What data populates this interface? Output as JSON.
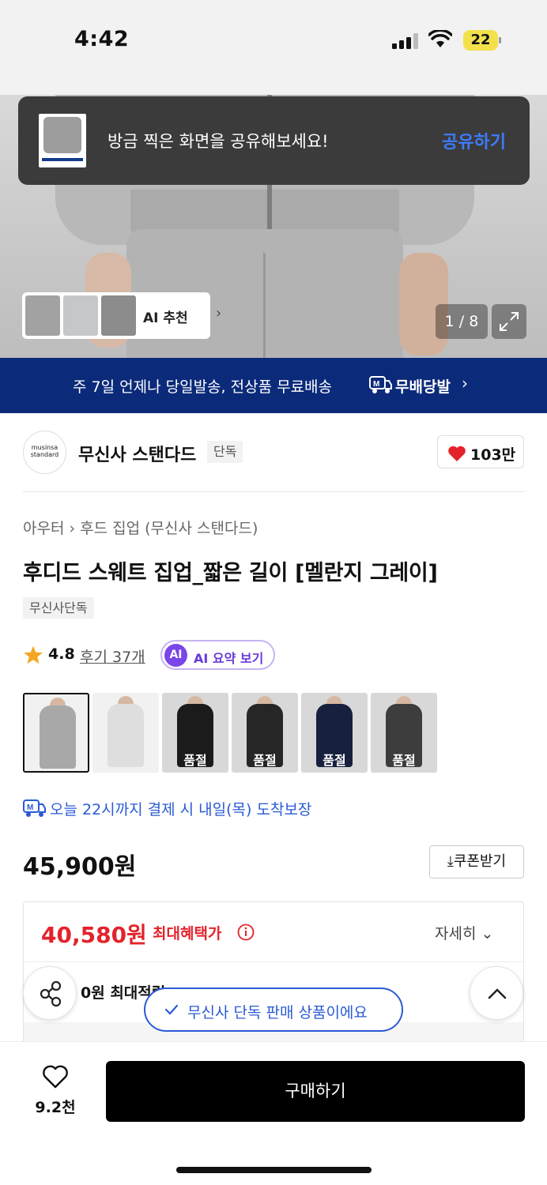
{
  "status_bar": {
    "time": "4:42",
    "battery": "22"
  },
  "toast": {
    "message": "방금 찍은 화면을 공유해보세요!",
    "action": "공유하기"
  },
  "gallery": {
    "ai_chip_label": "AI 추천",
    "counter": "1 / 8"
  },
  "banner": {
    "text": "주 7일 언제나 당일발송, 전상품 무료배송",
    "logo_text": "무배당발",
    "logo_icon": "truck-m-icon"
  },
  "brand": {
    "logo_line1": "musinsa",
    "logo_line2": "standard",
    "name": "무신사 스탠다드",
    "badge": "단독",
    "likes": "103만"
  },
  "product": {
    "category": "아우터",
    "subcategory": "후드 집업 (무신사 스탠다드)",
    "title": "후디드 스웨트 집업_짧은 길이 [멜란지 그레이]",
    "exclusive_tag": "무신사단독",
    "rating": "4.8",
    "reviews": "후기 37개",
    "ai_summary": "AI 요약 보기",
    "ai_badge": "AI"
  },
  "color_options": [
    {
      "color": "#a8a8a8",
      "sold_out": ""
    },
    {
      "color": "#dedede",
      "sold_out": ""
    },
    {
      "color": "#1b1b1b",
      "sold_out": "품절"
    },
    {
      "color": "#262626",
      "sold_out": "품절"
    },
    {
      "color": "#17203d",
      "sold_out": "품절"
    },
    {
      "color": "#3d3d3d",
      "sold_out": "품절"
    }
  ],
  "delivery": {
    "text": "오늘 22시까지 결제 시 내일(목) 도착보장"
  },
  "pricing": {
    "price": "45,900원",
    "coupon": "쿠폰받기",
    "benefit_price": "40,580원",
    "benefit_label": "최대혜택가",
    "detail": "자세히",
    "points": "0원 최대적립"
  },
  "exclusive_toast": "무신사 단독 판매 상품이에요",
  "bottom": {
    "wish_count": "9.2천",
    "buy": "구매하기"
  },
  "colors": {
    "brand_blue": "#0b2a7a",
    "accent_red": "#e3232b",
    "link_blue": "#2a5ad6",
    "ai_purple": "#7a46e8"
  }
}
